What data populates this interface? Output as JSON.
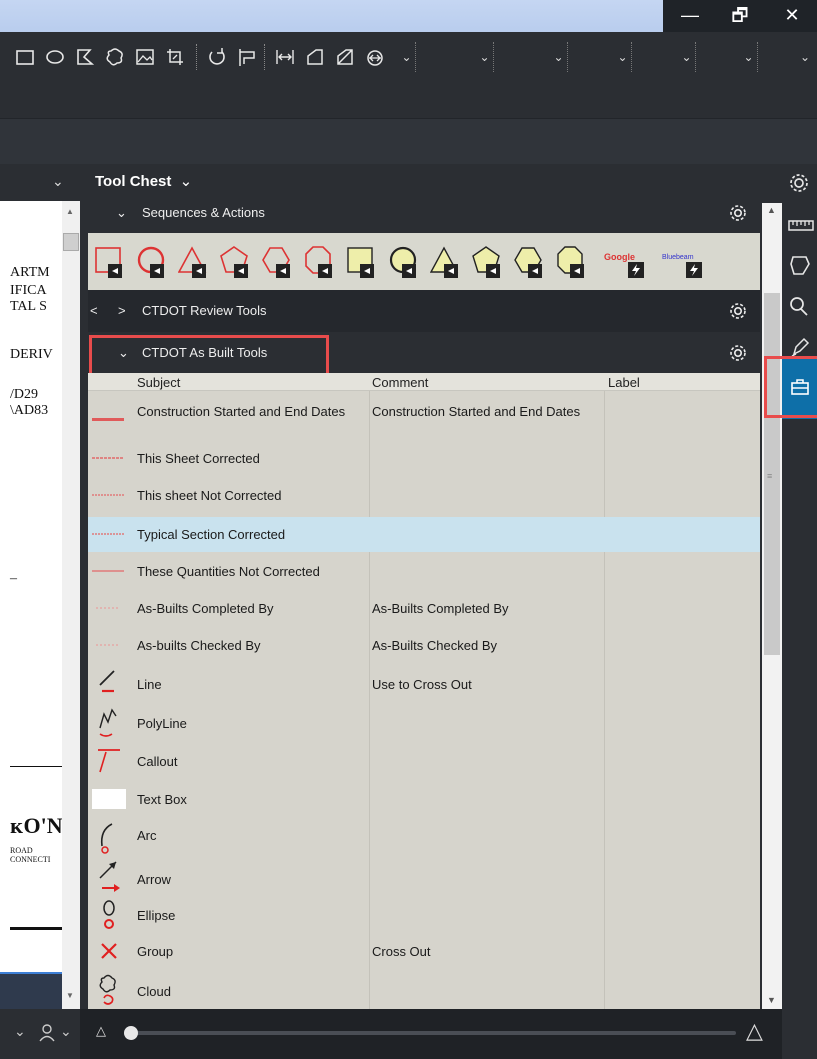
{
  "window": {
    "minimize": "—",
    "restore": "🗗",
    "close": "✕"
  },
  "toolbar": {
    "icons": [
      "rectangle-icon",
      "ellipse-icon",
      "polygon-icon",
      "cloud-icon",
      "image-icon",
      "crop-icon",
      "rotate-icon",
      "flip-icon",
      "measure-icon",
      "area-icon",
      "area2-icon",
      "snap-icon"
    ],
    "dropdown_glyph": "⌄"
  },
  "doc": {
    "header_glyph": "⌄",
    "lines": [
      "ARTM",
      "IFICA",
      "TAL S",
      "DERIV",
      "/D29",
      "\\AD83",
      "–",
      "ROAD",
      "CONNECTI"
    ],
    "logo_text": "ᴋO'N"
  },
  "panel": {
    "title": "Tool Chest",
    "title_chevron": "⌄",
    "sections": [
      {
        "label": "Sequences & Actions",
        "chevron": "⌄"
      },
      {
        "label": "CTDOT Review Tools",
        "chevron": ">"
      },
      {
        "label": "CTDOT As Built Tools",
        "chevron": "⌄"
      }
    ],
    "collapse_glyph": "<",
    "shape_tools": {
      "google_label": "Google",
      "bluebeam_label": "Bluebeam"
    }
  },
  "table": {
    "headers": {
      "subject": "Subject",
      "comment": "Comment",
      "label": "Label"
    },
    "rows": [
      {
        "subject": "Construction Started and End Dates",
        "comment": "Construction Started and End Dates"
      },
      {
        "subject": "This Sheet Corrected",
        "comment": ""
      },
      {
        "subject": "This sheet Not Corrected",
        "comment": ""
      },
      {
        "subject": "Typical Section Corrected",
        "comment": ""
      },
      {
        "subject": "These Quantities Not Corrected",
        "comment": ""
      },
      {
        "subject": "As-Builts Completed By",
        "comment": "As-Builts Completed By"
      },
      {
        "subject": "As-builts Checked By",
        "comment": "As-Builts Checked By"
      },
      {
        "subject": "Line",
        "comment": "Use to Cross Out"
      },
      {
        "subject": "PolyLine",
        "comment": ""
      },
      {
        "subject": "Callout",
        "comment": ""
      },
      {
        "subject": "Text Box",
        "comment": ""
      },
      {
        "subject": "Arc",
        "comment": ""
      },
      {
        "subject": "Arrow",
        "comment": ""
      },
      {
        "subject": "Ellipse",
        "comment": ""
      },
      {
        "subject": "Group",
        "comment": "Cross Out"
      },
      {
        "subject": "Cloud",
        "comment": ""
      }
    ]
  },
  "bottom": {
    "left_glyph": "⌄",
    "user_glyph": "⌄",
    "triangle_small": "△",
    "triangle_large": "△"
  },
  "colors": {
    "accent_red": "#e84c4c",
    "selected_row": "#c9e2ee",
    "active_rail": "#0e6fa8"
  }
}
